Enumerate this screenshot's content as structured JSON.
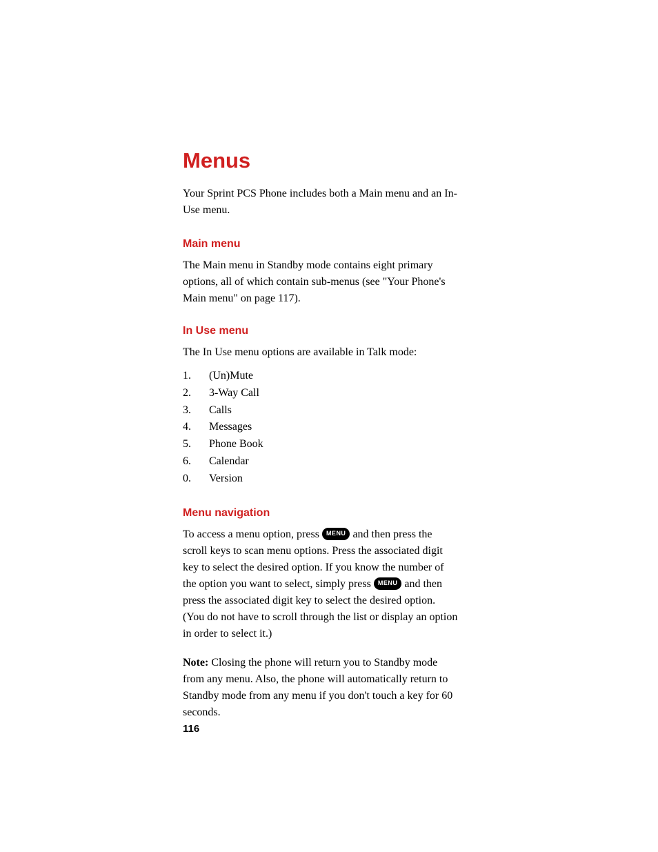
{
  "page_title": "Menus",
  "intro": "Your Sprint PCS Phone includes both a Main menu and an In-Use menu.",
  "main_menu": {
    "heading": "Main menu",
    "text": "The Main menu in Standby mode contains eight primary options, all of which contain sub-menus (see \"Your Phone's Main menu\" on page 117)."
  },
  "in_use_menu": {
    "heading": "In Use menu",
    "intro": "The In Use menu options are available in Talk mode:",
    "items": [
      {
        "num": "1.",
        "label": "(Un)Mute"
      },
      {
        "num": "2.",
        "label": "3-Way Call"
      },
      {
        "num": "3.",
        "label": "Calls"
      },
      {
        "num": "4.",
        "label": "Messages"
      },
      {
        "num": "5.",
        "label": "Phone Book"
      },
      {
        "num": "6.",
        "label": "Calendar"
      },
      {
        "num": "0.",
        "label": "Version"
      }
    ]
  },
  "menu_navigation": {
    "heading": "Menu navigation",
    "text_part1": "To access a menu option, press ",
    "button1": "MENU",
    "text_part2": " and then press the scroll keys to scan menu options. Press the associated digit key to select the desired option. If you know the number of the option you want to select, simply press ",
    "button2": "MENU",
    "text_part3": " and then press the associated digit key to select the desired option. (You do not have to scroll through the list or display an option in order to select it.)",
    "note_label": "Note:",
    "note_text": "  Closing the phone will return you to Standby mode from any menu. Also, the phone will automatically return to Standby mode from any menu if you don't touch a key for 60 seconds."
  },
  "page_number": "116"
}
